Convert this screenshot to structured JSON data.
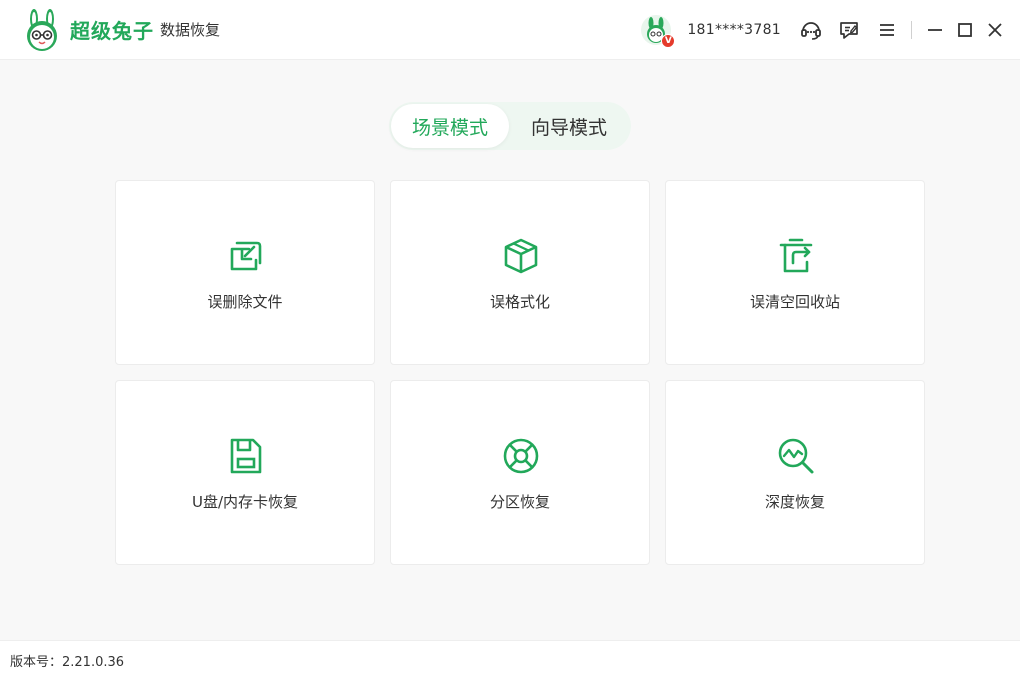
{
  "app": {
    "brand_name": "超级兔子",
    "brand_sub": "数据恢复"
  },
  "user": {
    "phone": "181****3781",
    "vip_badge": "V"
  },
  "icons": {
    "support": "headset-chat-icon",
    "feedback": "message-edit-icon",
    "menu": "hamburger-menu-icon",
    "minimize": "minimize-icon",
    "maximize": "maximize-icon",
    "close": "close-icon"
  },
  "mode_tabs": [
    {
      "label": "场景模式",
      "active": true
    },
    {
      "label": "向导模式",
      "active": false
    }
  ],
  "scenarios": [
    {
      "label": "误删除文件",
      "icon": "file-restore-icon"
    },
    {
      "label": "误格式化",
      "icon": "cube-format-icon"
    },
    {
      "label": "误清空回收站",
      "icon": "recycle-bin-icon"
    },
    {
      "label": "U盘/内存卡恢复",
      "icon": "sd-card-icon"
    },
    {
      "label": "分区恢复",
      "icon": "partition-icon"
    },
    {
      "label": "深度恢复",
      "icon": "deep-scan-icon"
    }
  ],
  "footer": {
    "version": "版本号：2.21.0.36"
  },
  "colors": {
    "accent": "#22a85a",
    "badge": "#e53b2c"
  }
}
